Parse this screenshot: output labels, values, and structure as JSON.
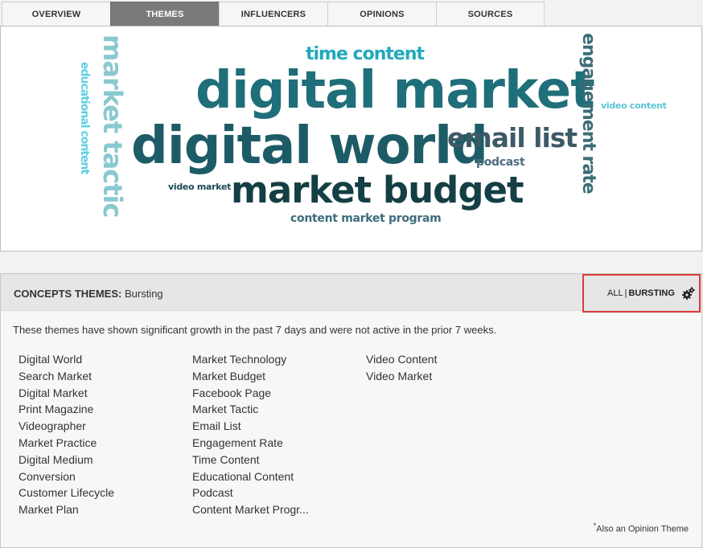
{
  "tabs": [
    {
      "label": "OVERVIEW",
      "active": false
    },
    {
      "label": "THEMES",
      "active": true
    },
    {
      "label": "INFLUENCERS",
      "active": false
    },
    {
      "label": "OPINIONS",
      "active": false
    },
    {
      "label": "SOURCES",
      "active": false
    }
  ],
  "word_cloud": [
    {
      "text": "digital market",
      "color": "#1f6f7a"
    },
    {
      "text": "digital world",
      "color": "#1d5c67"
    },
    {
      "text": "market budget",
      "color": "#143f44"
    },
    {
      "text": "email list",
      "color": "#3b5a66"
    },
    {
      "text": "market tactic",
      "color": "#8ac9cf"
    },
    {
      "text": "engagement rate",
      "color": "#3c6d77"
    },
    {
      "text": "time content",
      "color": "#22a9bb"
    },
    {
      "text": "educational content",
      "color": "#5fd0e0"
    },
    {
      "text": "video content",
      "color": "#5bc4d6"
    },
    {
      "text": "podcast",
      "color": "#4d6e7e"
    },
    {
      "text": "video market",
      "color": "#1d4a54"
    },
    {
      "text": "content market program",
      "color": "#3e6c7d"
    }
  ],
  "panel": {
    "title_bold": "CONCEPTS THEMES:",
    "title_value": "Bursting",
    "filter_all": "ALL",
    "filter_sep": "|",
    "filter_bursting": "BURSTING",
    "description": "These themes have shown significant growth in the past 7 days and were not active in the prior 7 weeks.",
    "columns": [
      [
        "Digital World",
        "Search Market",
        "Digital Market",
        "Print Magazine",
        "Videographer",
        "Market Practice",
        "Digital Medium",
        "Conversion",
        "Customer Lifecycle",
        "Market Plan"
      ],
      [
        "Market Technology",
        "Market Budget",
        "Facebook Page",
        "Market Tactic",
        "Email List",
        "Engagement Rate",
        "Time Content",
        "Educational Content",
        "Podcast",
        "Content Market Progr..."
      ],
      [
        "Video Content",
        "Video Market"
      ]
    ],
    "footnote_mark": "*",
    "footnote_text": "Also an Opinion Theme"
  }
}
